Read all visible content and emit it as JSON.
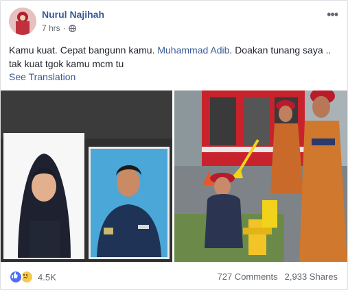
{
  "post": {
    "author": "Nurul Najihah",
    "time": "7 hrs",
    "separator": "·",
    "text_before": "Kamu kuat. Cepat bangunn kamu. ",
    "mention": "Muhammad Adib",
    "text_after": ". Doakan tunang saya .. tak kuat tgok kamu mcm tu",
    "translate_label": "See Translation"
  },
  "footer": {
    "reaction_count": "4.5K",
    "comments": "727 Comments",
    "shares": "2,933 Shares"
  },
  "colors": {
    "link_blue": "#385898",
    "like_blue": "#4c6ef5",
    "sad_yellow": "#f7c84a"
  },
  "icons": {
    "more": "more-options-icon",
    "privacy": "globe-icon",
    "reaction_like": "like-reaction-icon",
    "reaction_sad": "sad-reaction-icon"
  }
}
